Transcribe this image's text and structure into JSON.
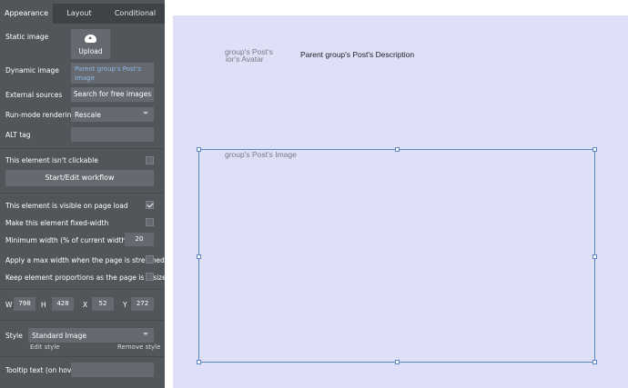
{
  "tabs": [
    "Appearance",
    "Layout",
    "Conditional"
  ],
  "static_image": {
    "label": "Static image",
    "upload_label": "Upload"
  },
  "dynamic_image": {
    "label": "Dynamic image",
    "value": "Parent group's Post's Image"
  },
  "external_sources": {
    "label": "External sources",
    "button": "Search for free images"
  },
  "run_mode": {
    "label": "Run-mode rendering",
    "value": "Rescale"
  },
  "alt_tag": {
    "label": "ALT tag",
    "value": ""
  },
  "not_clickable": {
    "label": "This element isn't clickable",
    "checked": false
  },
  "workflow_button": "Start/Edit workflow",
  "visible_on_load": {
    "label": "This element is visible on page load",
    "checked": true
  },
  "fixed_width": {
    "label": "Make this element fixed-width",
    "checked": false
  },
  "min_width": {
    "label": "Minimum width (% of current width)",
    "value": "20"
  },
  "max_width": {
    "label": "Apply a max width when the page is stretched",
    "checked": false
  },
  "keep_proportions": {
    "label": "Keep element proportions as the page is resized",
    "checked": false
  },
  "dims": {
    "w_label": "W",
    "w": "798",
    "h_label": "H",
    "h": "428",
    "x_label": "X",
    "x": "52",
    "y_label": "Y",
    "y": "272"
  },
  "style": {
    "label": "Style",
    "value": "Standard Image",
    "edit": "Edit style",
    "remove": "Remove style"
  },
  "tooltip": {
    "label": "Tooltip text (on hover)",
    "value": ""
  },
  "canvas": {
    "avatar_line1": "group's Post's",
    "avatar_line2": "ior's Avatar",
    "description": "Parent group's Post's Description",
    "image_label": "group's Post's Image"
  },
  "colors": {
    "panel": "#51565b",
    "field": "#646a70",
    "canvas": "#dde0f7",
    "selection": "#5b86c2",
    "link": "#8fb8e8"
  },
  "icons": {
    "upload": "cloud-upload-icon",
    "dropdown": "chevron-down-icon",
    "check": "check-icon"
  }
}
